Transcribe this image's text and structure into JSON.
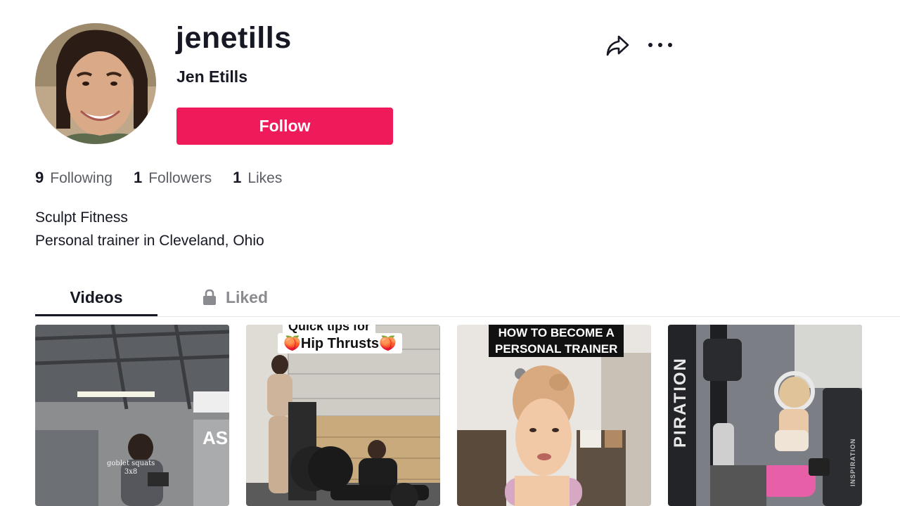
{
  "profile": {
    "username": "jenetills",
    "nickname": "Jen Etills",
    "follow_label": "Follow"
  },
  "stats": [
    {
      "count": "9",
      "label": "Following"
    },
    {
      "count": "1",
      "label": "Followers"
    },
    {
      "count": "1",
      "label": "Likes"
    }
  ],
  "bio": {
    "line1": "Sculpt Fitness",
    "line2": "Personal trainer in Cleveland, Ohio"
  },
  "tabs": {
    "videos": "Videos",
    "liked": "Liked"
  },
  "icons": {
    "share": "share-icon",
    "more": "more-icon",
    "lock": "lock-icon"
  },
  "colors": {
    "follow_button": "#ef1a59",
    "text_primary": "#161823",
    "text_secondary": "#5c5e66"
  },
  "videos": [
    {
      "overlay_line1": "goblet squats",
      "overlay_line2": "3x8"
    },
    {
      "caption_top": "Quick tips for",
      "caption_main": "🍑Hip Thrusts🍑"
    },
    {
      "caption_line1": "HOW TO BECOME A",
      "caption_line2": "PERSONAL TRAINER"
    },
    {
      "side_text": "PIRATION",
      "machine_text": "INSPIRATION"
    }
  ]
}
